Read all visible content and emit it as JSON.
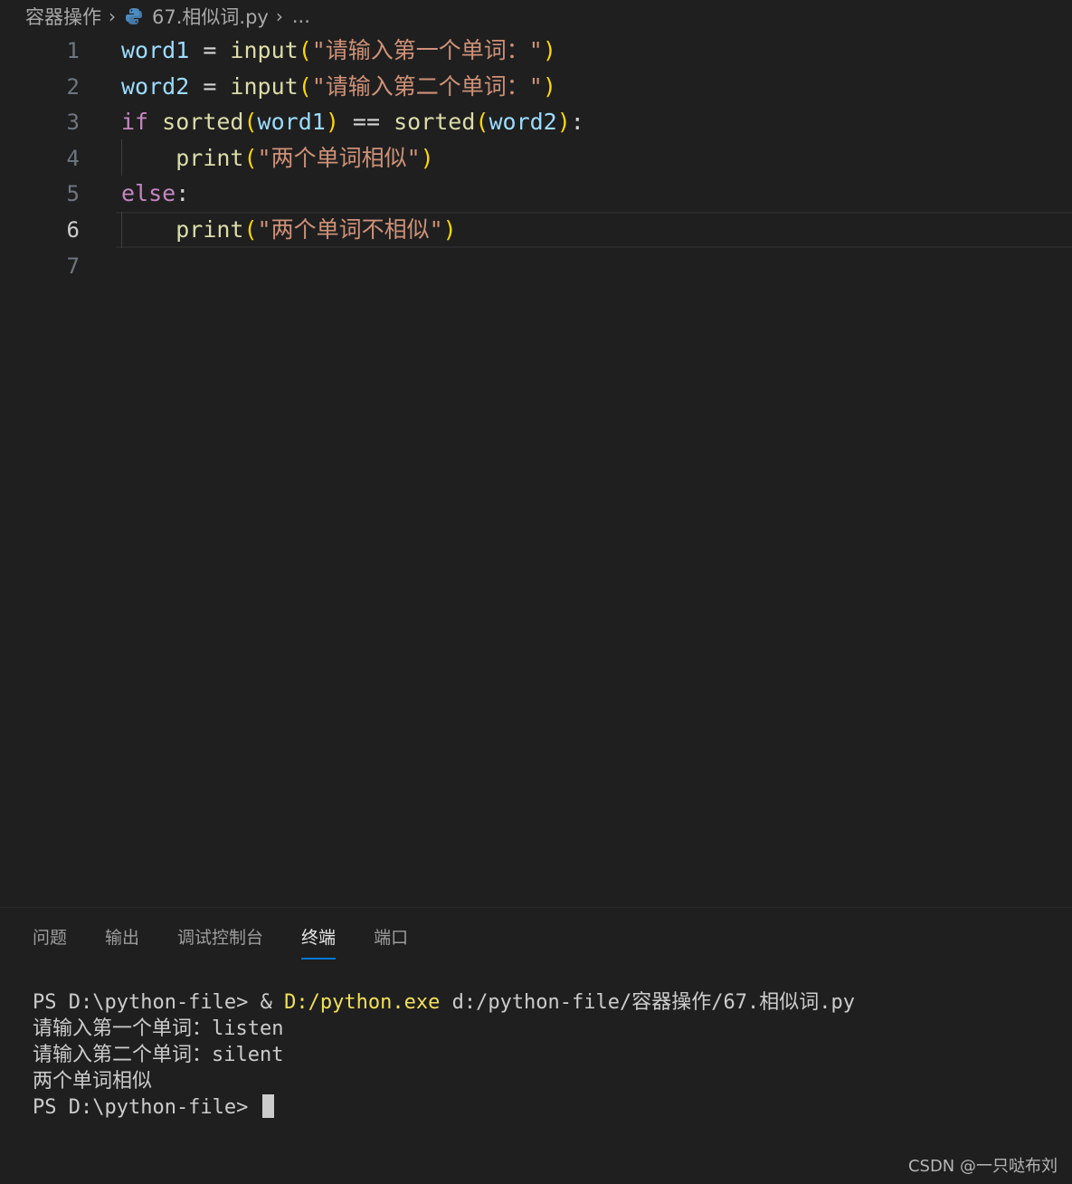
{
  "breadcrumb": {
    "folder": "容器操作",
    "file": "67.相似词.py",
    "more": "..."
  },
  "editor": {
    "active_line": 6,
    "lines": [
      {
        "num": "1",
        "tokens": [
          {
            "t": "var",
            "v": "word1"
          },
          {
            "t": "op",
            "v": " = "
          },
          {
            "t": "fn",
            "v": "input"
          },
          {
            "t": "p1",
            "v": "("
          },
          {
            "t": "str",
            "v": "\"请输入第一个单词：\""
          },
          {
            "t": "p1",
            "v": ")"
          }
        ]
      },
      {
        "num": "2",
        "tokens": [
          {
            "t": "var",
            "v": "word2"
          },
          {
            "t": "op",
            "v": " = "
          },
          {
            "t": "fn",
            "v": "input"
          },
          {
            "t": "p1",
            "v": "("
          },
          {
            "t": "str",
            "v": "\"请输入第二个单词：\""
          },
          {
            "t": "p1",
            "v": ")"
          }
        ]
      },
      {
        "num": "3",
        "tokens": [
          {
            "t": "kw",
            "v": "if"
          },
          {
            "t": "op",
            "v": " "
          },
          {
            "t": "fn",
            "v": "sorted"
          },
          {
            "t": "p1",
            "v": "("
          },
          {
            "t": "var",
            "v": "word1"
          },
          {
            "t": "p1",
            "v": ")"
          },
          {
            "t": "op",
            "v": " == "
          },
          {
            "t": "fn",
            "v": "sorted"
          },
          {
            "t": "p1",
            "v": "("
          },
          {
            "t": "var",
            "v": "word2"
          },
          {
            "t": "p1",
            "v": ")"
          },
          {
            "t": "op",
            "v": ":"
          }
        ]
      },
      {
        "num": "4",
        "tokens": [
          {
            "t": "op",
            "v": "    "
          },
          {
            "t": "fn",
            "v": "print"
          },
          {
            "t": "p1",
            "v": "("
          },
          {
            "t": "str",
            "v": "\"两个单词相似\""
          },
          {
            "t": "p1",
            "v": ")"
          }
        ]
      },
      {
        "num": "5",
        "tokens": [
          {
            "t": "kw",
            "v": "else"
          },
          {
            "t": "op",
            "v": ":"
          }
        ]
      },
      {
        "num": "6",
        "tokens": [
          {
            "t": "op",
            "v": "    "
          },
          {
            "t": "fn",
            "v": "print"
          },
          {
            "t": "p1",
            "v": "("
          },
          {
            "t": "str",
            "v": "\"两个单词不相似\""
          },
          {
            "t": "p1",
            "v": ")"
          }
        ]
      },
      {
        "num": "7",
        "tokens": []
      }
    ]
  },
  "panel": {
    "tabs": [
      {
        "label": "问题",
        "active": false
      },
      {
        "label": "输出",
        "active": false
      },
      {
        "label": "调试控制台",
        "active": false
      },
      {
        "label": "终端",
        "active": true
      },
      {
        "label": "端口",
        "active": false
      }
    ],
    "terminal": {
      "line1_prompt": "PS D:\\python-file> & ",
      "line1_exe": "D:/python.exe",
      "line1_arg": " d:/python-file/容器操作/67.相似词.py",
      "line2": "请输入第一个单词：listen",
      "line3": "请输入第二个单词：silent",
      "line4": "两个单词相似",
      "line5_prompt": "PS D:\\python-file> "
    }
  },
  "watermark": "CSDN @一只哒布刘",
  "colors": {
    "background": "#1f1f1f",
    "variable": "#9cdcfe",
    "function": "#dcdcaa",
    "string": "#ce9178",
    "keyword": "#c586c0",
    "bracket": "#ffd700",
    "tab_accent": "#0078d4"
  }
}
